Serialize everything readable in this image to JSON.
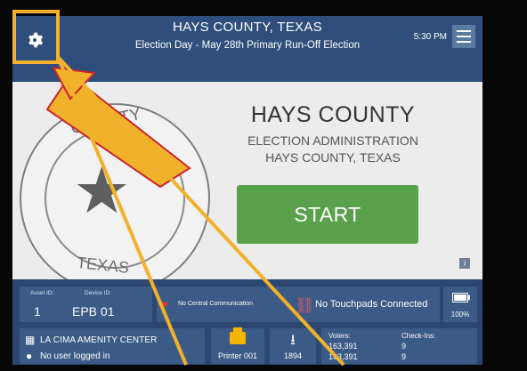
{
  "header": {
    "title": "HAYS COUNTY, TEXAS",
    "subtitle": "Election Day - May 28th Primary Run-Off Election",
    "time": "5:30 PM"
  },
  "main": {
    "seal_top_text": "COUNTY",
    "seal_bottom_text": "TEXAS",
    "heading": "HAYS COUNTY",
    "subheading_1": "ELECTION ADMINISTRATION",
    "subheading_2": "HAYS COUNTY, TEXAS",
    "start_label": "START",
    "info_label": "i"
  },
  "status_panel": {
    "asset_id_label": "Asset ID:",
    "asset_id": "1",
    "device_id_label": "Device ID:",
    "device_id": "EPB 01",
    "central_status": "No Central Communication",
    "touchpads_status": "No Touchpads Connected",
    "battery": "100%",
    "location": "LA CIMA AMENITY CENTER",
    "user_status": "No user logged in",
    "printer": "Printer 001",
    "download_count": "1894",
    "voters_label": "Voters:",
    "voters_1": "163,391",
    "voters_2": "163,391",
    "checkins_label": "Check-Ins:",
    "checkins_1": "9",
    "checkins_2": "9"
  },
  "icons": [
    "gear-icon",
    "hamburger-menu-icon",
    "info-icon",
    "broken-heart-icon",
    "broken-link-icon",
    "battery-icon",
    "location-icon",
    "user-icon",
    "printer-icon",
    "download-icon"
  ],
  "colors": {
    "topbar": "#2f4e7b",
    "start": "#5aa14b",
    "annotation": "#f2b12b",
    "warning": "#e3342f"
  }
}
